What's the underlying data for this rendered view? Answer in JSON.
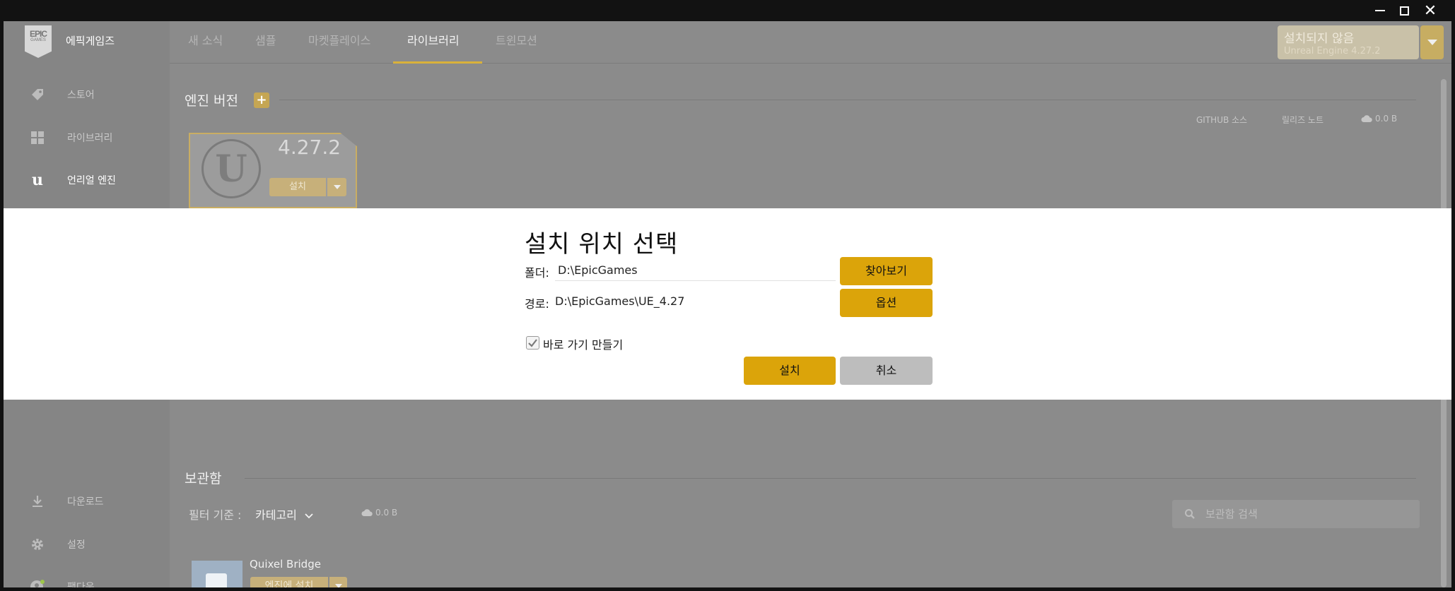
{
  "window": {
    "minimize": "minimize",
    "maximize": "maximize",
    "close": "✕"
  },
  "sidebar": {
    "brand": "에픽게임즈",
    "logo_top": "EPIC",
    "logo_bottom": "GAMES",
    "items": [
      {
        "label": "스토어",
        "icon": "tag-icon"
      },
      {
        "label": "라이브러리",
        "icon": "grid-icon"
      },
      {
        "label": "언리얼 엔진",
        "icon": "unreal-icon",
        "active": true
      }
    ],
    "bottom_items": [
      {
        "label": "다운로드",
        "icon": "download-icon"
      },
      {
        "label": "설정",
        "icon": "gear-icon"
      },
      {
        "label": "팽다욱",
        "icon": "user-icon"
      }
    ]
  },
  "topnav": {
    "tabs": [
      "새 소식",
      "샘플",
      "마켓플레이스",
      "라이브러리",
      "트윈모션"
    ],
    "active_tab": "라이브러리",
    "status_line1": "설치되지 않음",
    "status_line2": "Unreal Engine 4.27.2"
  },
  "engine": {
    "section_title": "엔진 버전",
    "github_link": "GITHUB 소스",
    "release_notes": "릴리즈 노트",
    "size": "0.0 B",
    "version": "4.27.2",
    "install_label": "설치"
  },
  "vault": {
    "section_title": "보관함",
    "filter_label": "필터 기준 :",
    "filter_value": "카테고리",
    "size": "0.0 B",
    "search_placeholder": "보관함 검색",
    "asset_name": "Quixel Bridge",
    "asset_button": "엔진에 설치"
  },
  "dialog": {
    "title": "설치 위치 선택",
    "folder_label": "폴더:",
    "folder_value": "D:\\EpicGames",
    "browse_label": "찾아보기",
    "path_label": "경로:",
    "path_value": "D:\\EpicGames\\UE_4.27",
    "options_label": "옵션",
    "shortcut_label": "바로 가기 만들기",
    "shortcut_checked": true,
    "install_label": "설치",
    "cancel_label": "취소"
  },
  "colors": {
    "accent": "#dba40a",
    "overlay": "#8b8b8b",
    "dialog_bg": "#ffffff"
  }
}
